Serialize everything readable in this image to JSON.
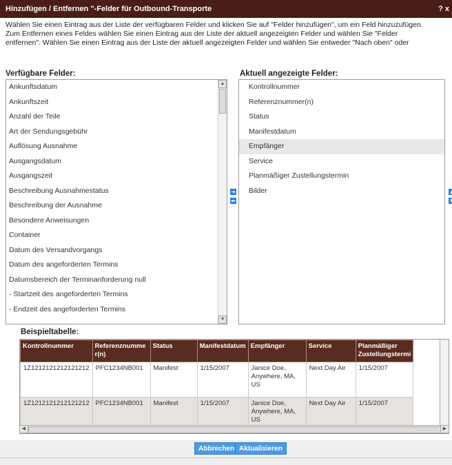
{
  "dialog": {
    "title": "Hinzufügen / Entfernen \"-Felder für Outbound-Transporte",
    "help_label": "? x",
    "instructions": [
      "Wählen Sie einen Eintrag aus  der Liste der verfügbaren Felder und klicken Sie auf  \"Felder hinzufügen\", um ein Feld hinzuzufügen.",
      "Zum Entfernen eines Feldes wählen Sie einen Eintrag aus  der Liste der aktuell angezeigten Felder und wählen Sie \"Felder",
      "entfernen\".  Wählen Sie einen Eintrag aus  der Liste der aktuell angezeigten Felder und wählen Sie entweder \"Nach oben\" oder"
    ]
  },
  "available": {
    "label": "Verfügbare Felder:",
    "items": [
      "Ankunftsdatum",
      "Ankunftszeit",
      "Anzahl der Teile",
      "Art der Sendungsgebühr",
      "Auflösung Ausnahme",
      "Ausgangsdatum",
      "Ausgangszeit",
      "Beschreibung Ausnahmestatus",
      "Beschreibung der Ausnahme",
      "Besondere Anweisungen",
      "Container",
      "Datum des Versandvorgangs",
      "Datum des angeforderten Termins",
      "Datumsbereich der Terminanforderung null",
      " - Startzeit des angeforderten Termins",
      " - Endzeit des angeforderten Termins"
    ]
  },
  "current": {
    "label": "Aktuell angezeigte Felder:",
    "items": [
      "Kontrollnummer",
      "Referenznummer(n)",
      "Status",
      "Manifestdatum",
      "Empfänger",
      "Service",
      "Planmäßiger Zustellungstermin",
      "Bilder"
    ],
    "selected_index": 4
  },
  "icons": {
    "add": "arrow-right-icon",
    "remove": "arrow-left-icon",
    "move_up": "arrow-up-icon",
    "move_down": "arrow-down-icon"
  },
  "sample": {
    "label": "Beispieltabelle:",
    "columns": [
      "Kontrollnummer",
      "Referenznumme r(n)",
      "Status",
      "Manifestdatum",
      "Empfänger",
      "Service",
      "Planmäßiger Zustellungstermi"
    ],
    "rows": [
      [
        "1Z1212121212121212",
        "PFC1234NB001",
        "Manifest",
        "1/15/2007",
        "Janice Doe, Anywhere, MA, US",
        "Next Day Air",
        "1/15/2007"
      ],
      [
        "1Z1212121212121212",
        "PFC1234NB001",
        "Manifest",
        "1/15/2007",
        "Janice Doe, Anywhere, MA, US",
        "Next Day Air",
        "1/15/2007"
      ]
    ]
  },
  "buttons": {
    "cancel": "Abbrechen",
    "update": "Aktualisieren"
  },
  "colors": {
    "titlebar": "#4b1d18",
    "table_header": "#5a2b1f",
    "button": "#4b9be6",
    "arrow": "#2b7fd6"
  }
}
